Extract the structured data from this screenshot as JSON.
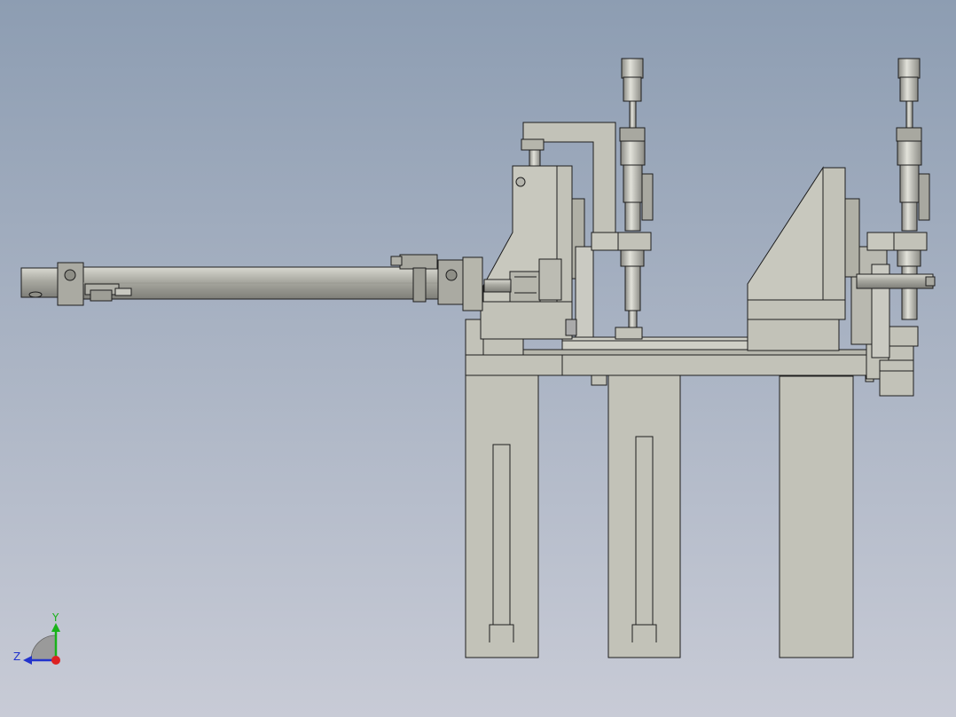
{
  "viewport": {
    "background_top": "#8d9db2",
    "background_bottom": "#c8cbd6"
  },
  "model": {
    "part_color": "#c2c2b8",
    "part_shade": "#aeaea4",
    "metal_color": "#b4b4ac",
    "metal_dark": "#8e8e86",
    "edge_color": "#1e1e1e",
    "highlight": "#e4e4dc"
  },
  "triad": {
    "y_label": "Y",
    "z_label": "Z",
    "y_color": "#19b219",
    "z_color": "#2233cc",
    "x_color": "#dd2222",
    "arc_color": "#9a9a9a"
  }
}
